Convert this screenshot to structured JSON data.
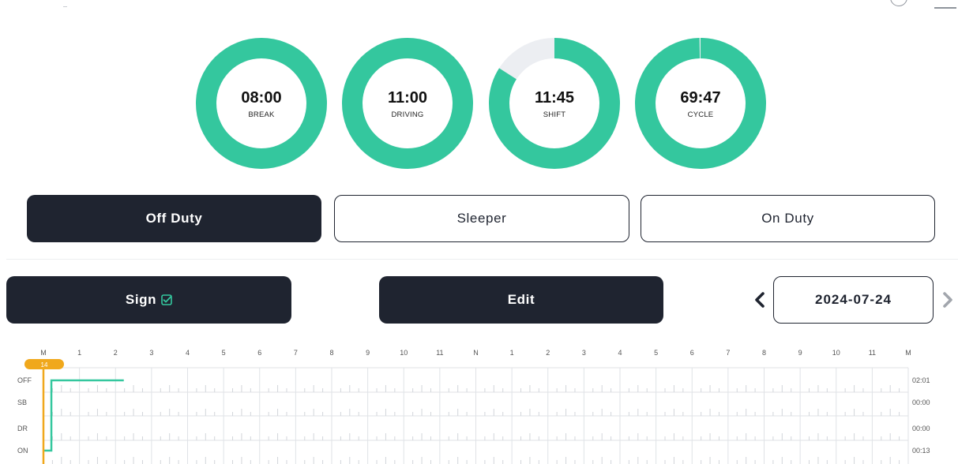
{
  "gauges": [
    {
      "value": "08:00",
      "label": "BREAK",
      "remaining_fraction": 1.0
    },
    {
      "value": "11:00",
      "label": "DRIVING",
      "remaining_fraction": 1.0
    },
    {
      "value": "11:45",
      "label": "SHIFT",
      "remaining_fraction": 0.84
    },
    {
      "value": "69:47",
      "label": "CYCLE",
      "remaining_fraction": 0.997
    }
  ],
  "colors": {
    "accent": "#34c79e",
    "track": "#eceef2",
    "dark": "#1f2430",
    "marker": "#f0a81c"
  },
  "status": {
    "off_duty": "Off Duty",
    "sleeper": "Sleeper",
    "on_duty": "On Duty",
    "active": "off_duty"
  },
  "actions": {
    "sign": "Sign",
    "edit": "Edit"
  },
  "date_nav": {
    "date": "2024-07-24",
    "prev_icon": "chevron-left-icon",
    "next_icon": "chevron-right-icon"
  },
  "log": {
    "hour_labels": [
      "M",
      "1",
      "2",
      "3",
      "4",
      "5",
      "6",
      "7",
      "8",
      "9",
      "10",
      "11",
      "N",
      "1",
      "2",
      "3",
      "4",
      "5",
      "6",
      "7",
      "8",
      "9",
      "10",
      "11",
      "M"
    ],
    "rows": [
      "OFF",
      "SB",
      "DR",
      "ON"
    ],
    "totals": [
      "02:01",
      "00:00",
      "00:00",
      "00:13"
    ],
    "current_marker": "14",
    "events": [
      {
        "status": "ON",
        "start_hour": 0.0,
        "end_hour": 0.22
      },
      {
        "status": "OFF",
        "start_hour": 0.22,
        "end_hour": 2.23
      }
    ]
  }
}
